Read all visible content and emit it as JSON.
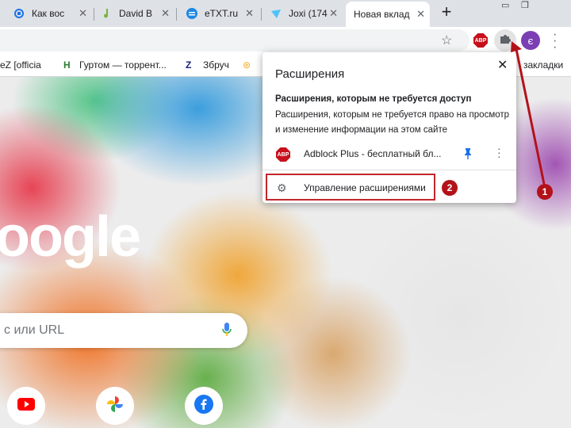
{
  "tabs": [
    {
      "label": "Как вос",
      "icon": "refresh-icon"
    },
    {
      "label": "David B",
      "icon": "music-note-icon"
    },
    {
      "label": "eTXT.ru",
      "icon": "etxt-icon"
    },
    {
      "label": "Joxi (174",
      "icon": "joxi-icon"
    },
    {
      "label": "Новая вклад",
      "icon": ""
    }
  ],
  "toolbar": {
    "extension_icon": "ABP",
    "avatar_letter": "є"
  },
  "bookmarks": [
    {
      "label": "eZ [officia"
    },
    {
      "label": "Гуртом — торрент..."
    },
    {
      "label": "Збруч"
    },
    {
      "label": "закладки"
    }
  ],
  "page": {
    "logo_text": "oogle",
    "search_placeholder": "с или URL"
  },
  "popup": {
    "title": "Расширения",
    "close": "✕",
    "section_heading": "Расширения, которым не требуется доступ",
    "section_description": "Расширения, которым не требуется право на просмотр и изменение информации на этом сайте",
    "extension_name": "Adblock Plus - бесплатный бл...",
    "manage_label": "Управление расширениями"
  },
  "annotations": {
    "badge_1": "1",
    "badge_2": "2",
    "color": "#b3121a"
  }
}
